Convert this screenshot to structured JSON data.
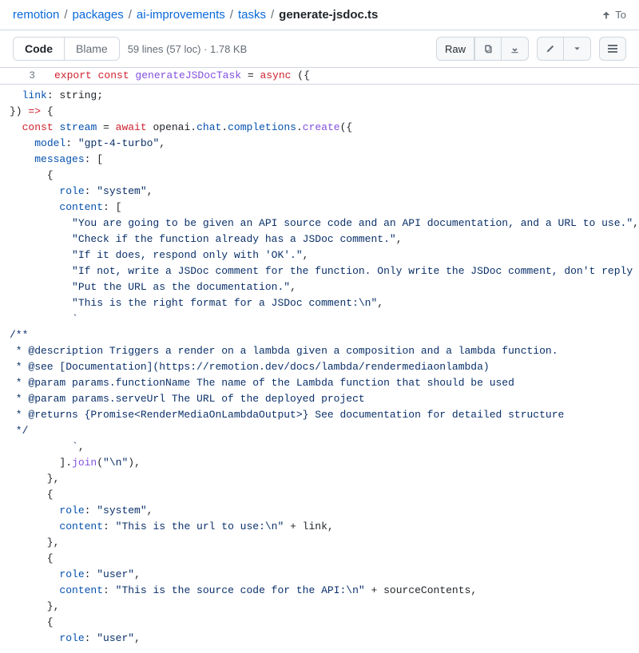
{
  "breadcrumb": {
    "items": [
      "remotion",
      "packages",
      "ai-improvements",
      "tasks"
    ],
    "current": "generate-jsdoc.ts",
    "sep": "/",
    "top": "To"
  },
  "toolbar": {
    "code": "Code",
    "blame": "Blame",
    "fileinfo": "59 lines (57 loc) · 1.78 KB",
    "raw": "Raw"
  },
  "sticky": {
    "lineno": "3",
    "tokens": [
      {
        "c": "k",
        "t": "export "
      },
      {
        "c": "k",
        "t": "const "
      },
      {
        "c": "fn",
        "t": "generateJSDocTask"
      },
      {
        "c": "pl",
        "t": " = "
      },
      {
        "c": "k",
        "t": "async"
      },
      {
        "c": "pl",
        "t": " ({"
      }
    ]
  },
  "code_lines": [
    [
      {
        "c": "pl",
        "t": "  "
      },
      {
        "c": "p",
        "t": "link"
      },
      {
        "c": "pl",
        "t": ": string;"
      }
    ],
    [
      {
        "c": "pl",
        "t": "}) "
      },
      {
        "c": "k",
        "t": "=>"
      },
      {
        "c": "pl",
        "t": " {"
      }
    ],
    [
      {
        "c": "pl",
        "t": "  "
      },
      {
        "c": "k",
        "t": "const"
      },
      {
        "c": "pl",
        "t": " "
      },
      {
        "c": "p",
        "t": "stream"
      },
      {
        "c": "pl",
        "t": " = "
      },
      {
        "c": "k",
        "t": "await"
      },
      {
        "c": "pl",
        "t": " openai."
      },
      {
        "c": "p",
        "t": "chat"
      },
      {
        "c": "pl",
        "t": "."
      },
      {
        "c": "p",
        "t": "completions"
      },
      {
        "c": "pl",
        "t": "."
      },
      {
        "c": "fn",
        "t": "create"
      },
      {
        "c": "pl",
        "t": "({"
      }
    ],
    [
      {
        "c": "pl",
        "t": "    "
      },
      {
        "c": "p",
        "t": "model"
      },
      {
        "c": "pl",
        "t": ": "
      },
      {
        "c": "s",
        "t": "\"gpt-4-turbo\""
      },
      {
        "c": "pl",
        "t": ","
      }
    ],
    [
      {
        "c": "pl",
        "t": "    "
      },
      {
        "c": "p",
        "t": "messages"
      },
      {
        "c": "pl",
        "t": ": ["
      }
    ],
    [
      {
        "c": "pl",
        "t": "      {"
      }
    ],
    [
      {
        "c": "pl",
        "t": "        "
      },
      {
        "c": "p",
        "t": "role"
      },
      {
        "c": "pl",
        "t": ": "
      },
      {
        "c": "s",
        "t": "\"system\""
      },
      {
        "c": "pl",
        "t": ","
      }
    ],
    [
      {
        "c": "pl",
        "t": "        "
      },
      {
        "c": "p",
        "t": "content"
      },
      {
        "c": "pl",
        "t": ": ["
      }
    ],
    [
      {
        "c": "pl",
        "t": "          "
      },
      {
        "c": "s",
        "t": "\"You are going to be given an API source code and an API documentation, and a URL to use.\""
      },
      {
        "c": "pl",
        "t": ","
      }
    ],
    [
      {
        "c": "pl",
        "t": "          "
      },
      {
        "c": "s",
        "t": "\"Check if the function already has a JSDoc comment.\""
      },
      {
        "c": "pl",
        "t": ","
      }
    ],
    [
      {
        "c": "pl",
        "t": "          "
      },
      {
        "c": "s",
        "t": "\"If it does, respond only with 'OK'.\""
      },
      {
        "c": "pl",
        "t": ","
      }
    ],
    [
      {
        "c": "pl",
        "t": "          "
      },
      {
        "c": "s",
        "t": "\"If not, write a JSDoc comment for the function. Only write the JSDoc comment, don't reply anything"
      }
    ],
    [
      {
        "c": "pl",
        "t": "          "
      },
      {
        "c": "s",
        "t": "\"Put the URL as the documentation.\""
      },
      {
        "c": "pl",
        "t": ","
      }
    ],
    [
      {
        "c": "pl",
        "t": "          "
      },
      {
        "c": "s",
        "t": "\"This is the right format for a JSDoc comment:\\n\""
      },
      {
        "c": "pl",
        "t": ","
      }
    ],
    [
      {
        "c": "pl",
        "t": "          "
      },
      {
        "c": "s",
        "t": "`"
      }
    ],
    [
      {
        "c": "s",
        "t": "/**"
      }
    ],
    [
      {
        "c": "s",
        "t": " * @description Triggers a render on a lambda given a composition and a lambda function."
      }
    ],
    [
      {
        "c": "s",
        "t": " * @see [Documentation](https://remotion.dev/docs/lambda/rendermediaonlambda)"
      }
    ],
    [
      {
        "c": "s",
        "t": " * @param params.functionName The name of the Lambda function that should be used"
      }
    ],
    [
      {
        "c": "s",
        "t": " * @param params.serveUrl The URL of the deployed project"
      }
    ],
    [
      {
        "c": "s",
        "t": " * @returns {Promise<RenderMediaOnLambdaOutput>} See documentation for detailed structure"
      }
    ],
    [
      {
        "c": "s",
        "t": " */"
      }
    ],
    [
      {
        "c": "pl",
        "t": "          "
      },
      {
        "c": "s",
        "t": "`"
      },
      {
        "c": "pl",
        "t": ","
      }
    ],
    [
      {
        "c": "pl",
        "t": "        ]."
      },
      {
        "c": "fn",
        "t": "join"
      },
      {
        "c": "pl",
        "t": "("
      },
      {
        "c": "s",
        "t": "\"\\n\""
      },
      {
        "c": "pl",
        "t": "),"
      }
    ],
    [
      {
        "c": "pl",
        "t": "      },"
      }
    ],
    [
      {
        "c": "pl",
        "t": "      {"
      }
    ],
    [
      {
        "c": "pl",
        "t": "        "
      },
      {
        "c": "p",
        "t": "role"
      },
      {
        "c": "pl",
        "t": ": "
      },
      {
        "c": "s",
        "t": "\"system\""
      },
      {
        "c": "pl",
        "t": ","
      }
    ],
    [
      {
        "c": "pl",
        "t": "        "
      },
      {
        "c": "p",
        "t": "content"
      },
      {
        "c": "pl",
        "t": ": "
      },
      {
        "c": "s",
        "t": "\"This is the url to use:\\n\""
      },
      {
        "c": "pl",
        "t": " + link,"
      }
    ],
    [
      {
        "c": "pl",
        "t": "      },"
      }
    ],
    [
      {
        "c": "pl",
        "t": "      {"
      }
    ],
    [
      {
        "c": "pl",
        "t": "        "
      },
      {
        "c": "p",
        "t": "role"
      },
      {
        "c": "pl",
        "t": ": "
      },
      {
        "c": "s",
        "t": "\"user\""
      },
      {
        "c": "pl",
        "t": ","
      }
    ],
    [
      {
        "c": "pl",
        "t": "        "
      },
      {
        "c": "p",
        "t": "content"
      },
      {
        "c": "pl",
        "t": ": "
      },
      {
        "c": "s",
        "t": "\"This is the source code for the API:\\n\""
      },
      {
        "c": "pl",
        "t": " + sourceContents,"
      }
    ],
    [
      {
        "c": "pl",
        "t": "      },"
      }
    ],
    [
      {
        "c": "pl",
        "t": "      {"
      }
    ],
    [
      {
        "c": "pl",
        "t": "        "
      },
      {
        "c": "p",
        "t": "role"
      },
      {
        "c": "pl",
        "t": ": "
      },
      {
        "c": "s",
        "t": "\"user\""
      },
      {
        "c": "pl",
        "t": ","
      }
    ]
  ]
}
